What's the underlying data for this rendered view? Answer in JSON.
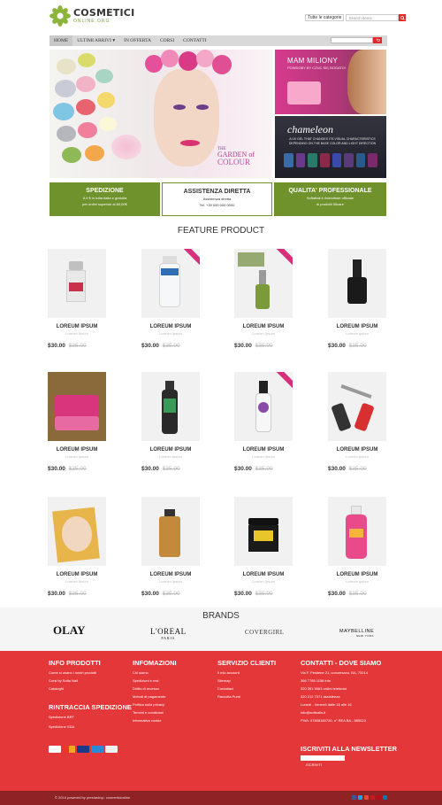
{
  "header": {
    "logo_title": "COSMETICI",
    "logo_sub": "ONLINE.ORG",
    "category_select": "Tutte le categorie",
    "search_placeholder": "Search items"
  },
  "nav": {
    "items": [
      "HOME",
      "ULTIMI ARRIVI",
      "IN OFFERTA",
      "CORSI",
      "CONTATTI"
    ]
  },
  "hero": {
    "caption_the": "THE",
    "caption_garden": "GARDEN of",
    "caption_colour": "COLOUR"
  },
  "promo1": {
    "title": "MAM MILIONY",
    "subtitle": "POWDOBY BY CZUC SIĘ BOGATO!"
  },
  "promo2": {
    "title": "chameleon",
    "desc": "A UV GEL THAT CHANGES ITS VISUAL CHARACTERISTICS DEPENDING ON THE BASE COLOR AND LIGHT DIRECTION"
  },
  "features": [
    {
      "title": "SPEDIZIONE",
      "lines": [
        "A 9 € in tutta Italia e gratuita",
        "per ordini superiori ai 80,00€"
      ]
    },
    {
      "title": "ASSISTENZA DIRETTA",
      "lines": [
        "Assistenza diretta",
        "Tel. +39 000 000 0000"
      ]
    },
    {
      "title": "QUALITA' PROFESSIONALE",
      "lines": [
        "Softaftail è rivenditore ufficiale",
        "di prodotti Silcare"
      ]
    }
  ],
  "feature_title": "FEATURE PRODUCT",
  "products": [
    {
      "name": "LOREUM IPSUM",
      "category": "Loreum Ipsum",
      "price": "$30.00",
      "old_price": "$35.00"
    },
    {
      "name": "LOREUM IPSUM",
      "category": "Loreum Ipsum",
      "price": "$30.00",
      "old_price": "$35.00"
    },
    {
      "name": "LOREUM IPSUM",
      "category": "Loreum Ipsum",
      "price": "$30.00",
      "old_price": "$35.00"
    },
    {
      "name": "LOREUM IPSUM",
      "category": "Loreum Ipsum",
      "price": "$30.00",
      "old_price": "$35.00"
    },
    {
      "name": "LOREUM IPSUM",
      "category": "Loreum Ipsum",
      "price": "$30.00",
      "old_price": "$35.00"
    },
    {
      "name": "LOREUM IPSUM",
      "category": "Loreum Ipsum",
      "price": "$30.00",
      "old_price": "$35.00"
    },
    {
      "name": "LOREUM IPSUM",
      "category": "Loreum Ipsum",
      "price": "$30.00",
      "old_price": "$35.00"
    },
    {
      "name": "LOREUM IPSUM",
      "category": "Loreum Ipsum",
      "price": "$30.00",
      "old_price": "$35.00"
    },
    {
      "name": "LOREUM IPSUM",
      "category": "Loreum Ipsum",
      "price": "$30.00",
      "old_price": "$35.00"
    },
    {
      "name": "LOREUM IPSUM",
      "category": "Loreum Ipsum",
      "price": "$30.00",
      "old_price": "$35.00"
    },
    {
      "name": "LOREUM IPSUM",
      "category": "Loreum Ipsum",
      "price": "$30.00",
      "old_price": "$35.00"
    },
    {
      "name": "LOREUM IPSUM",
      "category": "Loreum Ipsum",
      "price": "$30.00",
      "old_price": "$35.00"
    }
  ],
  "brands": {
    "title": "BRANDS",
    "logos": [
      "OLAY",
      "L'OREAL",
      "COVERGIRL",
      "MAYBELLINE"
    ],
    "loreal_sub": "PARIS",
    "maybelline_sub": "NEW YORK"
  },
  "footer": {
    "col1": {
      "title": "INFO PRODOTTI",
      "links": [
        "Come si usano i nostri prodotti",
        "Corsi by Sofia Nail",
        "Cataloghi"
      ],
      "title2": "RINTRACCIA SPEDIZIONE",
      "links2": [
        "Spedizione BRT",
        "Spedizione SDA"
      ]
    },
    "col2": {
      "title": "INFOMAZIONI",
      "links": [
        "Chi siamo",
        "Spedizioni e resi",
        "Diritto di recesso",
        "Metodi di pagamento",
        "Politica sulla privacy",
        "Termini e condizioni",
        "Informativa cookie"
      ]
    },
    "col3": {
      "title": "SERVIZIO CLIENTI",
      "links": [
        "Il mio account",
        "Sitemap",
        "Contattaci",
        "Raccolta Punti"
      ]
    },
    "col4": {
      "title": "CONTATTI - DOVE SIAMO",
      "links": [
        "Via F. Pestiene 21, conversano, BA, 70014",
        "366 7785 1158 info",
        "320 361 9063 ordini telefonici",
        "320 212 7371 assistenza",
        "Lunedì - Venerdì dalle 16 alle 16",
        "info@softnails.it",
        "PIVA: 07808180720, n° REA BA - 585023"
      ]
    },
    "newsletter_title": "ISCRIVITI ALLA NEWSLETTER",
    "newsletter_button": "ISCRIVITI",
    "payments": [
      "paypal",
      "mastercard",
      "visa",
      "amex",
      "bank"
    ],
    "colors": {
      "footer_bg": "#e3373a",
      "bottom_bg": "#8e2224",
      "accent_green": "#6f922d"
    }
  },
  "bottom": {
    "copyright": "© 2016 powered by prestashop. cosmeticionline",
    "social": [
      "facebook-icon",
      "twitter-icon",
      "google-icon",
      "youtube-icon",
      "pinterest-icon",
      "linkedin-icon"
    ]
  }
}
